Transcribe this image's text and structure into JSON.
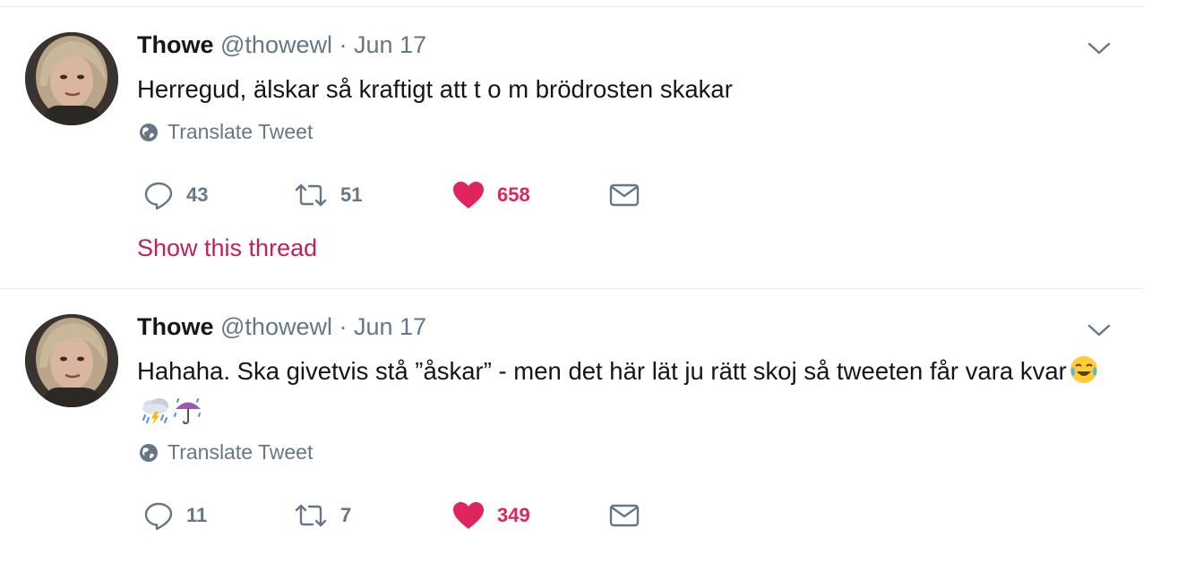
{
  "tweets": [
    {
      "fullname": "Thowe",
      "handle": "@thowewl",
      "separator": "·",
      "date": "Jun 17",
      "text": "Herregud, älskar så kraftigt att t o m brödrosten skakar",
      "translate_label": "Translate Tweet",
      "replies": "43",
      "retweets": "51",
      "likes": "658",
      "show_thread_label": "Show this thread"
    },
    {
      "fullname": "Thowe",
      "handle": "@thowewl",
      "separator": "·",
      "date": "Jun 17",
      "text": "Hahaha. Ska givetvis stå ”åskar” - men det här lät ju rätt skoj så tweeten får vara kvar",
      "emojis": [
        "face-with-tears-of-joy-emoji",
        "cloud-with-lightning-and-rain-emoji",
        "umbrella-with-rain-drops-emoji"
      ],
      "translate_label": "Translate Tweet",
      "replies": "11",
      "retweets": "7",
      "likes": "349"
    }
  ],
  "icons": {
    "reply": "reply-icon",
    "retweet": "retweet-icon",
    "like": "heart-icon",
    "dm": "envelope-icon",
    "translate": "globe-icon",
    "caret": "chevron-down-icon"
  },
  "colors": {
    "like_active": "#e0245e",
    "show_thread": "#c01f5e",
    "secondary_text": "#657786",
    "divider": "#e6ecf0"
  }
}
